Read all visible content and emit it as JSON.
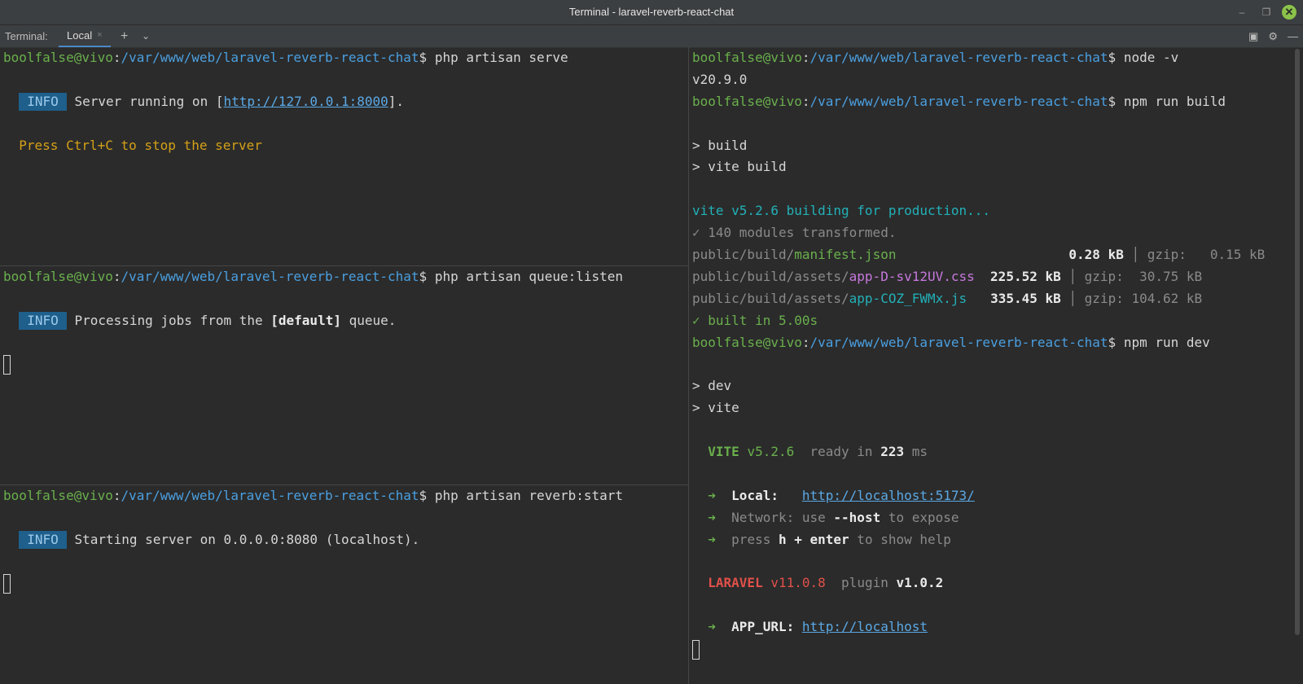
{
  "window": {
    "title": "Terminal - laravel-reverb-react-chat"
  },
  "toolwindow": {
    "label": "Terminal:",
    "tab": "Local",
    "tab_close": "×",
    "add": "+",
    "chevron": "⌄"
  },
  "prompt": {
    "user": "boolfalse@vivo",
    "colon": ":",
    "path": "/var/www/web/laravel-reverb-react-chat",
    "dollar": "$"
  },
  "left": {
    "pane1": {
      "cmd": "php artisan serve",
      "info": "INFO",
      "msg_pre": "Server running on [",
      "url": "http://127.0.0.1:8000",
      "msg_post": "].",
      "hint": "Press Ctrl+C to stop the server"
    },
    "pane2": {
      "cmd": "php artisan queue:listen",
      "info": "INFO",
      "msg_pre": "Processing jobs from the ",
      "msg_bold": "[default]",
      "msg_post": " queue."
    },
    "pane3": {
      "cmd": "php artisan reverb:start",
      "info": "INFO",
      "msg": "Starting server on 0.0.0.0:8080 (localhost)."
    }
  },
  "right": {
    "cmd1": "node -v",
    "node_version": "v20.9.0",
    "cmd2": "npm run build",
    "build1": "> build",
    "build2": "> vite build",
    "vite_building": "vite v5.2.6 building for production...",
    "transformed": "✓ 140 modules transformed.",
    "files": [
      {
        "dir": "public/build/",
        "name": "manifest.json",
        "pad": "               ",
        "size": "0.28 kB",
        "gzip": "gzip:   0.15 kB",
        "color": "lg"
      },
      {
        "dir": "public/build/assets/",
        "name": "app-D-sv12UV.css",
        "pad": "  ",
        "size": "225.52 kB",
        "gzip": "gzip:  30.75 kB",
        "color": "mg"
      },
      {
        "dir": "public/build/assets/",
        "name": "app-COZ_FWMx.js",
        "pad": "   ",
        "size": "335.45 kB",
        "gzip": "gzip: 104.62 kB",
        "color": "cy"
      }
    ],
    "built": "✓ built in 5.00s",
    "cmd3": "npm run dev",
    "dev1": "> dev",
    "dev2": "> vite",
    "vite_label": "VITE",
    "vite_version": "v5.2.6",
    "ready_pre": "ready in ",
    "ready_ms": "223",
    "ready_unit": " ms",
    "arrow": "➜",
    "local_label": "Local:",
    "local_url": "http://localhost:5173/",
    "network_label": "Network:",
    "network_pre": " use ",
    "network_bold": "--host",
    "network_post": " to expose",
    "help_pre": "press ",
    "help_bold": "h + enter",
    "help_post": " to show help",
    "laravel_label": "LARAVEL",
    "laravel_version": "v11.0.8",
    "plugin_label": "plugin",
    "plugin_version": "v1.0.2",
    "appurl_label": "APP_URL:",
    "appurl": "http://localhost"
  }
}
